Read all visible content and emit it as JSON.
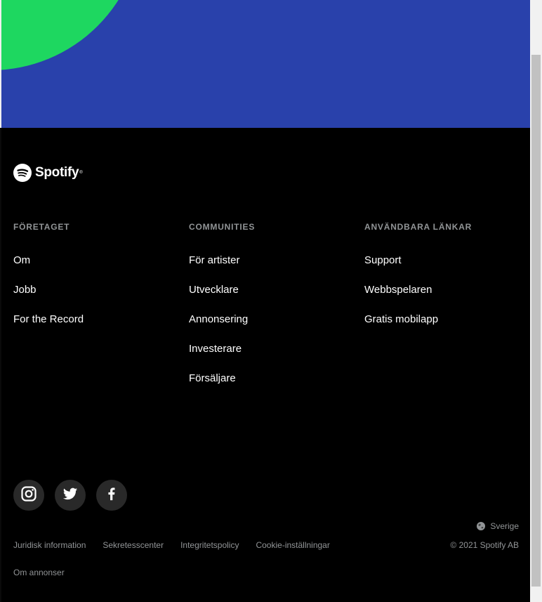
{
  "brand": {
    "name": "Spotify"
  },
  "columns": [
    {
      "heading": "FÖRETAGET",
      "links": [
        "Om",
        "Jobb",
        "For the Record"
      ]
    },
    {
      "heading": "COMMUNITIES",
      "links": [
        "För artister",
        "Utvecklare",
        "Annonsering",
        "Investerare",
        "Försäljare"
      ]
    },
    {
      "heading": "ANVÄNDBARA LÄNKAR",
      "links": [
        "Support",
        "Webbspelaren",
        "Gratis mobilapp"
      ]
    }
  ],
  "social": [
    "instagram-icon",
    "twitter-icon",
    "facebook-icon"
  ],
  "region": {
    "label": "Sverige",
    "icon": "globe-icon"
  },
  "legal": {
    "juridisk": "Juridisk information",
    "sekretess": "Sekretesscenter",
    "integritet": "Integritetspolicy",
    "cookie": "Cookie-inställningar",
    "annonser": "Om annonser"
  },
  "copyright": "© 2021 Spotify AB",
  "colors": {
    "hero_blue": "#2941ab",
    "spotify_green": "#1ed760",
    "footer_bg": "#000000",
    "muted_text": "#919496",
    "social_bg": "#292929"
  }
}
